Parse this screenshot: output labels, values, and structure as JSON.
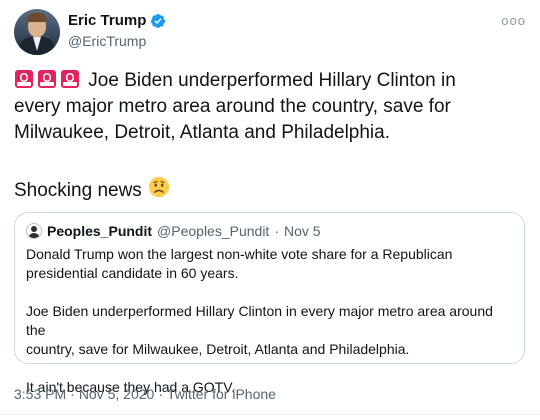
{
  "author": {
    "display_name": "Eric Trump",
    "handle": "@EricTrump",
    "verified_icon": "verified-badge-icon",
    "avatar_icon": "profile-photo"
  },
  "more_icon": "ellipsis-icon",
  "more_label": "ooo",
  "tweet": {
    "line1": "Joe Biden underperformed Hillary Clinton in",
    "line2": "every major metro area around the country, save for",
    "line3": "Milwaukee, Detroit, Atlanta and Philadelphia.",
    "siren_icon": "police-light-emoji",
    "shocking": "Shocking news",
    "shock_emoji_icon": "worried-face-emoji"
  },
  "quote": {
    "name": "Peoples_Pundit",
    "handle": "@Peoples_Pundit",
    "dot": "·",
    "date": "Nov 5",
    "para1": "Donald Trump won the largest non-white vote share for a Republican\npresidential candidate in 60 years.",
    "para2": "Joe Biden underperformed Hillary Clinton in every major metro area around the\ncountry, save for Milwaukee, Detroit, Atlanta and Philadelphia.",
    "para3": "It ain't because they had a GOTV."
  },
  "footer": {
    "time": "3:53 PM",
    "sep1": "·",
    "date": "Nov 5, 2020",
    "sep2": "·",
    "source": "Twitter for iPhone"
  },
  "colors": {
    "verified": "#1d9bf0",
    "siren_red": "#e0245e",
    "muted": "#536471",
    "border": "#cfd9de"
  }
}
